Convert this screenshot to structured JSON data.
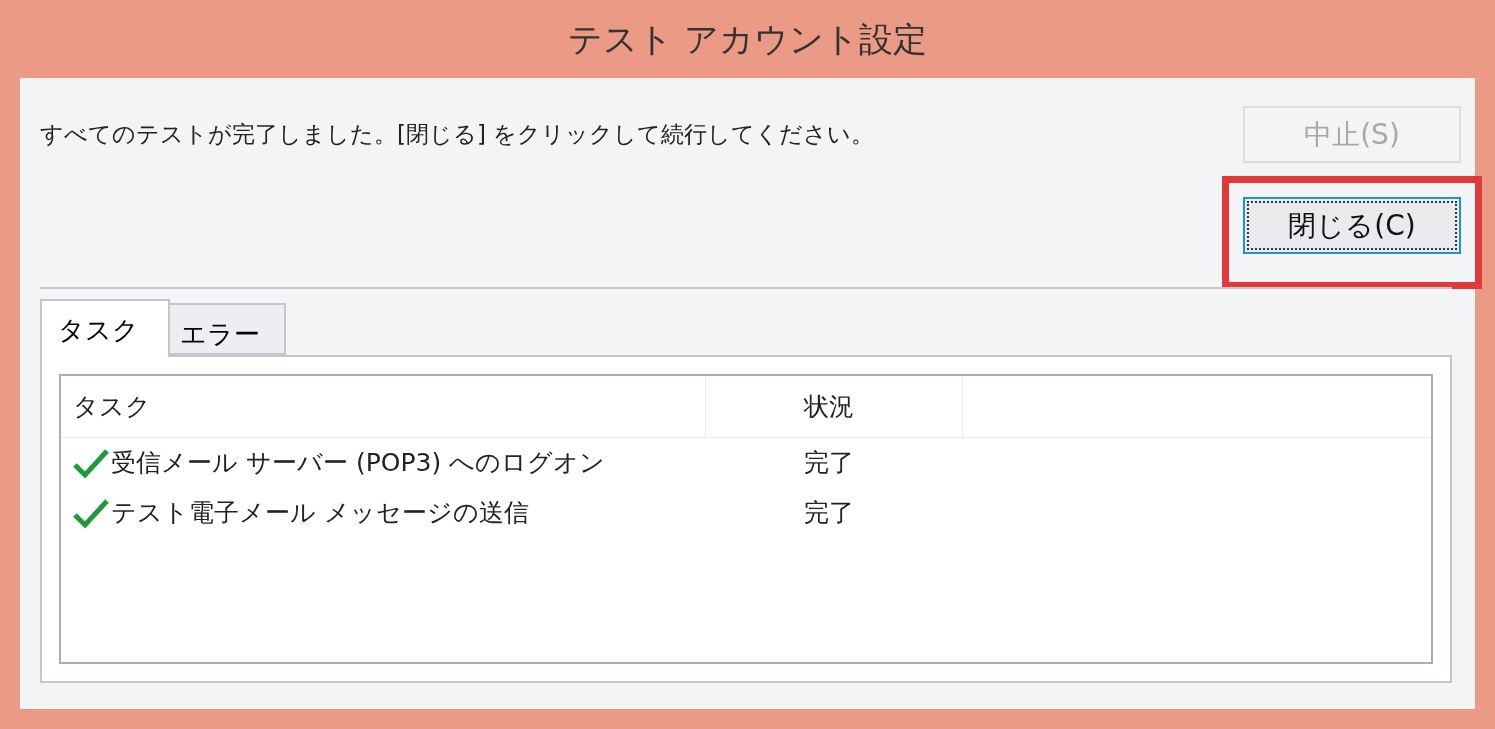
{
  "window": {
    "title": "テスト アカウント設定"
  },
  "message": "すべてのテストが完了しました。[閉じる] をクリックして続行してください。",
  "buttons": [
    {
      "label": "中止(S)",
      "disabled": true,
      "highlighted": false
    },
    {
      "label": "閉じる(C)",
      "disabled": false,
      "highlighted": true
    }
  ],
  "tabs": [
    {
      "label": "タスク",
      "selected": true
    },
    {
      "label": "エラー",
      "selected": false
    }
  ],
  "table": {
    "columns": [
      "タスク",
      "状況"
    ],
    "rows": [
      {
        "task": "受信メール サーバー (POP3) へのログオン",
        "status": "完了",
        "done": true
      },
      {
        "task": "テスト電子メール メッセージの送信",
        "status": "完了",
        "done": true
      }
    ]
  }
}
